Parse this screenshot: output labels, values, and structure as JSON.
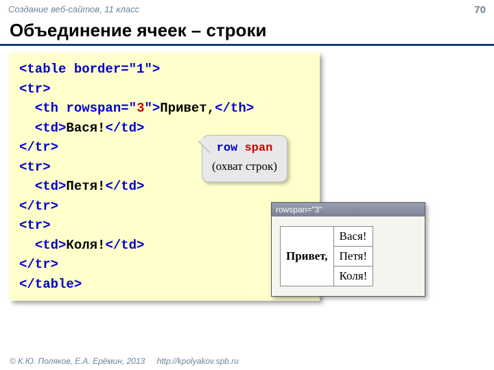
{
  "header": {
    "course": "Создание веб-сайтов, 11 класс",
    "page_number": "70"
  },
  "title": "Объединение ячеек – строки",
  "code": {
    "l1a": "<table ",
    "l1b": "border",
    "l1c": "=\"1\">",
    "l2": "<tr>",
    "l3a": "  <th ",
    "l3b": "rowspan",
    "l3c": "=\"",
    "l3d": "3",
    "l3e": "\">",
    "l3f": "Привет,",
    "l3g": "</th>",
    "l4a": "  <td>",
    "l4b": "Вася!",
    "l4c": "</td>",
    "l5": "</tr>",
    "l6": "<tr>",
    "l7a": "  <td>",
    "l7b": "Петя!",
    "l7c": "</td>",
    "l8": "</tr>",
    "l9": "<tr>",
    "l10a": "  <td>",
    "l10b": "Коля!",
    "l10c": "</td>",
    "l11": "</tr>",
    "l12": "</table>"
  },
  "callout": {
    "term_a": "row",
    "term_b": "span",
    "sub": "(охват строк)"
  },
  "preview": {
    "titlebar": "rowspan=\"3\"",
    "th": "Привет,",
    "td1": "Вася!",
    "td2": "Петя!",
    "td3": "Коля!"
  },
  "footer": {
    "copyright": "© К.Ю. Поляков, Е.А. Ерёмин, 2013",
    "url": "http://kpolyakov.spb.ru"
  }
}
